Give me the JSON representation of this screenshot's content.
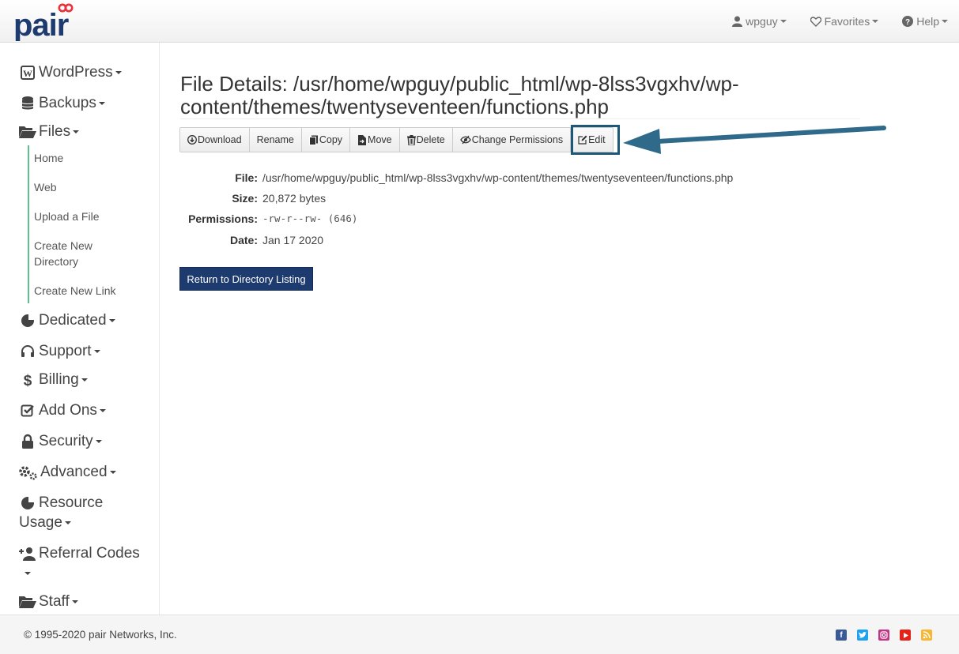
{
  "brand": {
    "logo_text": "pair",
    "accent": "#e8313a",
    "navy": "#1d3b6e"
  },
  "topnav": {
    "user_label": "wpguy",
    "favorites_label": "Favorites",
    "help_label": "Help"
  },
  "sidebar": {
    "items": [
      {
        "label": "WordPress",
        "icon": "wordpress-icon"
      },
      {
        "label": "Backups",
        "icon": "database-icon"
      },
      {
        "label": "Files",
        "icon": "folder-open-icon"
      },
      {
        "label": "Dedicated",
        "icon": "pie-chart-icon"
      },
      {
        "label": "Support",
        "icon": "headset-icon"
      },
      {
        "label": "Billing",
        "icon": "dollar-icon"
      },
      {
        "label": "Add Ons",
        "icon": "check-square-icon"
      },
      {
        "label": "Security",
        "icon": "lock-icon"
      },
      {
        "label": "Advanced",
        "icon": "gears-icon"
      },
      {
        "label_line1": "Resource",
        "label_line2": "Usage",
        "icon": "pie-chart-icon"
      },
      {
        "label": "Referral Codes",
        "icon": "user-plus-icon"
      },
      {
        "label": "Staff",
        "icon": "folder-open-icon"
      }
    ],
    "files_submenu": [
      {
        "label": "Home"
      },
      {
        "label": "Web"
      },
      {
        "label": "Upload a File"
      },
      {
        "label_line1": "Create New",
        "label_line2": "Directory"
      },
      {
        "label": "Create New Link"
      }
    ]
  },
  "main": {
    "title_line1": "File Details: /usr/home/wpguy/public_html/wp-8lss3vgxhv/wp-",
    "title_line2": "content/themes/twentyseventeen/functions.php",
    "actions": {
      "download": "Download",
      "rename": "Rename",
      "copy": "Copy",
      "move": "Move",
      "delete": "Delete",
      "change_permissions": "Change Permissions",
      "edit": "Edit"
    },
    "details": {
      "file_label": "File:",
      "file_value": "/usr/home/wpguy/public_html/wp-8lss3vgxhv/wp-content/themes/twentyseventeen/functions.php",
      "size_label": "Size:",
      "size_value": "20,872 bytes",
      "permissions_label": "Permissions:",
      "permissions_value": "-rw-r--rw- (646)",
      "date_label": "Date:",
      "date_value": "Jan 17 2020"
    },
    "return_button": "Return to Directory Listing"
  },
  "footer": {
    "copyright": "© 1995-2020 pair Networks, Inc.",
    "social": [
      {
        "icon": "facebook-icon",
        "color": "#3b5998"
      },
      {
        "icon": "twitter-icon",
        "color": "#1da1f2"
      },
      {
        "icon": "instagram-icon",
        "color": "#c13584"
      },
      {
        "icon": "youtube-icon",
        "color": "#e62117"
      },
      {
        "icon": "rss-icon",
        "color": "#f7b733"
      }
    ]
  }
}
